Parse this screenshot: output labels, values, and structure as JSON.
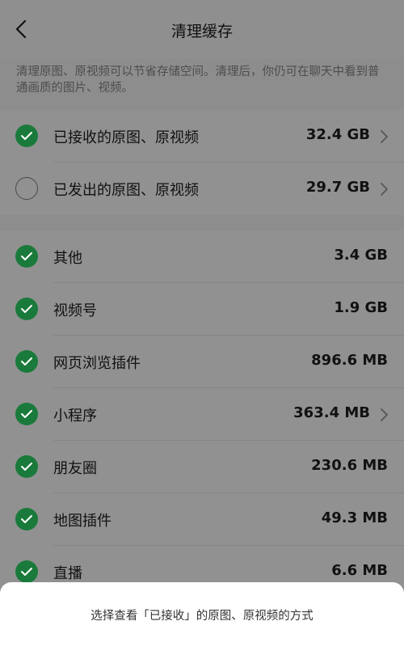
{
  "header": {
    "title": "清理缓存",
    "back_icon": "chevron-left-icon"
  },
  "description": "清理原图、原视频可以节省存储空间。清理后，你仍可在聊天中看到普通画质的图片、视频。",
  "group1": [
    {
      "label": "已接收的原图、原视频",
      "value": "32.4 GB",
      "checked": true,
      "has_chevron": true
    },
    {
      "label": "已发出的原图、原视频",
      "value": "29.7 GB",
      "checked": false,
      "has_chevron": true
    }
  ],
  "group2": [
    {
      "label": "其他",
      "value": "3.4 GB",
      "checked": true,
      "has_chevron": false
    },
    {
      "label": "视频号",
      "value": "1.9 GB",
      "checked": true,
      "has_chevron": false
    },
    {
      "label": "网页浏览插件",
      "value": "896.6 MB",
      "checked": true,
      "has_chevron": false
    },
    {
      "label": "小程序",
      "value": "363.4 MB",
      "checked": true,
      "has_chevron": true
    },
    {
      "label": "朋友圈",
      "value": "230.6 MB",
      "checked": true,
      "has_chevron": false
    },
    {
      "label": "地图插件",
      "value": "49.3 MB",
      "checked": true,
      "has_chevron": false
    },
    {
      "label": "直播",
      "value": "6.6 MB",
      "checked": true,
      "has_chevron": false
    }
  ],
  "sheet": {
    "text": "选择查看「已接收」的原图、原视频的方式"
  },
  "colors": {
    "check_green": "#1a7a3b",
    "overlay_gray": "#8d8d8d"
  }
}
